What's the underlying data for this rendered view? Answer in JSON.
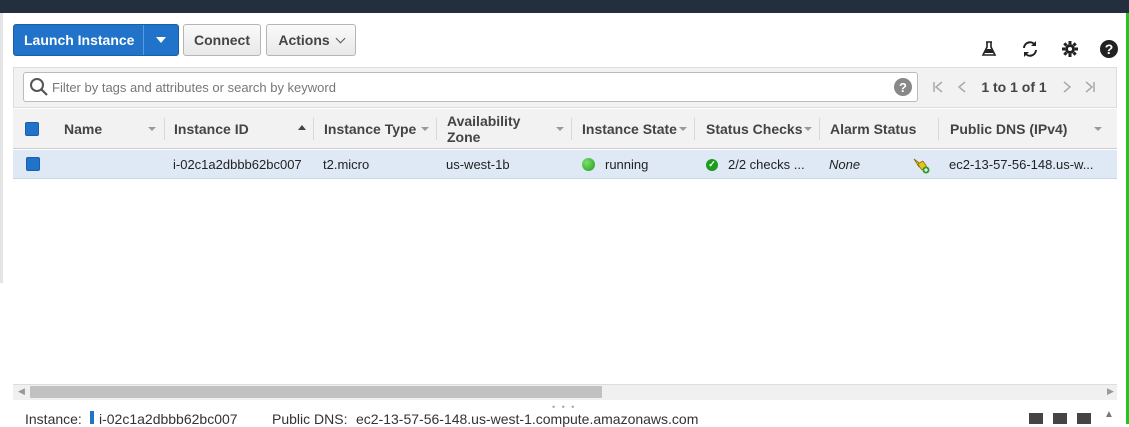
{
  "toolbar": {
    "launch_label": "Launch Instance",
    "connect_label": "Connect",
    "actions_label": "Actions"
  },
  "icons": [
    "flask-icon",
    "refresh-icon",
    "gear-icon",
    "help-icon"
  ],
  "filter": {
    "placeholder": "Filter by tags and attributes or search by keyword",
    "help": "?",
    "pagination": "1 to 1 of 1"
  },
  "table": {
    "columns": [
      "Name",
      "Instance ID",
      "Instance Type",
      "Availability Zone",
      "Instance State",
      "Status Checks",
      "Alarm Status",
      "Public DNS (IPv4)"
    ],
    "sorted_column": "Instance ID",
    "rows": [
      {
        "selected": true,
        "name": "",
        "instance_id": "i-02c1a2dbbb62bc007",
        "instance_type": "t2.micro",
        "availability_zone": "us-west-1b",
        "instance_state": "running",
        "status_checks": "2/2 checks ...",
        "alarm_status": "None",
        "public_dns": "ec2-13-57-56-148.us-w..."
      }
    ]
  },
  "detail": {
    "instance_label": "Instance:",
    "instance_value": "i-02c1a2dbbb62bc007",
    "dns_label": "Public DNS:",
    "dns_value": "ec2-13-57-56-148.us-west-1.compute.amazonaws.com"
  },
  "colors": {
    "accent": "#2073c9",
    "running": "#1d9b1d",
    "selected_row": "#dfe9f5",
    "header_bar": "#232f3e"
  }
}
